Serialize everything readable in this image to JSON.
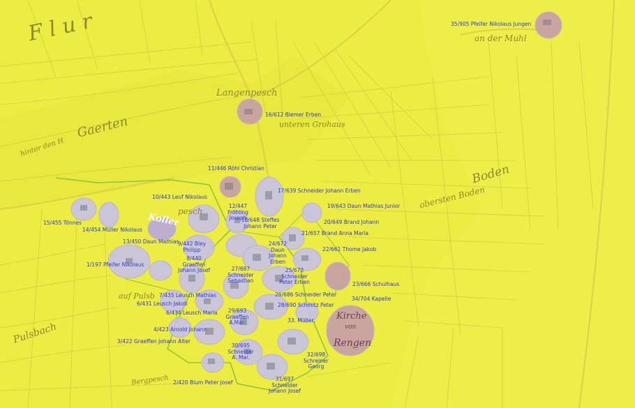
{
  "map": {
    "colors": {
      "background": "#ecec42",
      "label": "#2b3bd6",
      "parcel_line": "#c9c94a",
      "highlight_fill": "#c8c2e8",
      "boundary": "#7fbf3a"
    },
    "place_names": {
      "flur": "F l u r",
      "langenpesch": "Langenpesch",
      "gaerten": "Gaerten",
      "hinter_den_h": "hinter den H",
      "unteren_grohaus": "unteren Grohaus",
      "obersten_boden": "obersten Boden",
      "boden": "Boden",
      "koller": "Koller",
      "pesch": "pesch",
      "auf_pulsbach": "auf Pulsb",
      "pulsbach": "Pulsbach",
      "berg": "Bergpesch",
      "an_der_muhl": "an der Muhl",
      "kirche": "Kirche",
      "von": "von",
      "rengen": "Rengen"
    },
    "labels": {
      "l35": "35/905 Pfeifer Nikolaus Jungen",
      "l16": "16/612 Biemer Erben",
      "l11": "11/446 Röhl Christian",
      "l17": "17/639 Schneider Johann Erben",
      "l10": "10/443 Leuf Nikolaus",
      "l12": "12/447 Fröhling Joseph",
      "l19": "19/643 Daun Mathias Junior",
      "l15": "15/455 Tönnes",
      "l14": "14/454 Müller Nikolaus",
      "l18": "18/648 Steffes Johann Peter",
      "l20": "20/649 Brand Johann",
      "l21": "21/657 Brand Anna Maria",
      "l13": "13/450 Daun Mathias",
      "l9": "9/442 Bley Philipp",
      "l24": "24/672 Daun Johann Erben",
      "l22": "22/661 Thome Jakob",
      "l8": "8/440 Graeffen Johann Josef",
      "l1": "1/197 Pfeifer Nikolaus",
      "l27": "27/687 Schneider Sebastian",
      "l25": "25/673 Schneider Peter Erben",
      "l23": "23/666 Schulhaus",
      "l7": "7/435 Leusch Mathias",
      "l26": "26/686 Schneider Peter",
      "l34": "34/704 Kapelle",
      "l6": "6/431 Leusch Jakob",
      "l28": "28/690 Schmitz Peter",
      "l5": "6/434 Leusch Maria",
      "l29": "29/693 Graeffen A.Mar.",
      "l33": "33. Müller,",
      "l4": "4/423 Arnold Johann",
      "l3": "3/422 Graeffen Johann Alter",
      "l30": "30/695 Schneider A. Mar.",
      "l32": "32/698 Schreiner Georg",
      "l2": "2/420 Blum Peter Josef",
      "l31": "31/697 Schneider Johann Josef"
    }
  }
}
